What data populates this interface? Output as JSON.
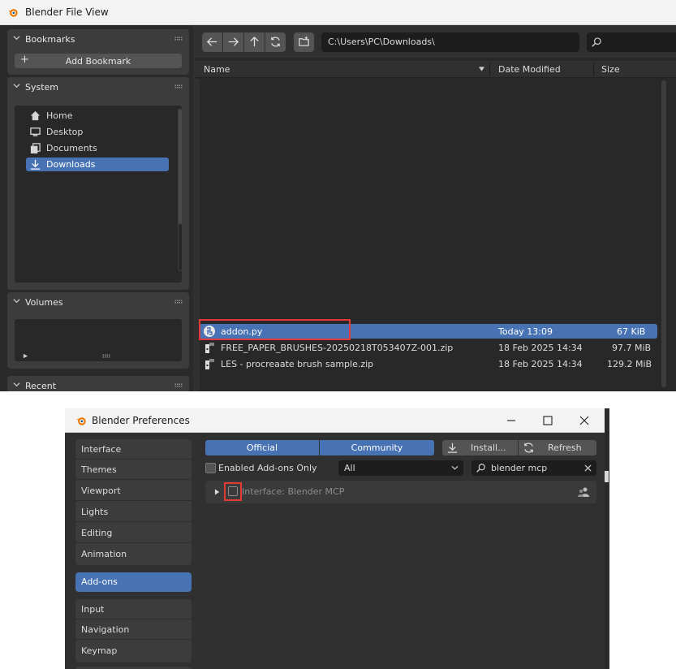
{
  "file_view": {
    "title": "Blender File View",
    "bookmarks": {
      "header": "Bookmarks",
      "add_label": "Add Bookmark"
    },
    "system": {
      "header": "System",
      "items": [
        {
          "label": "Home",
          "icon": "home-icon"
        },
        {
          "label": "Desktop",
          "icon": "desktop-icon"
        },
        {
          "label": "Documents",
          "icon": "documents-icon"
        },
        {
          "label": "Downloads",
          "icon": "download-icon",
          "selected": true
        }
      ]
    },
    "volumes": {
      "header": "Volumes"
    },
    "recent": {
      "header": "Recent"
    },
    "path": "C:\\Users\\PC\\Downloads\\",
    "columns": {
      "name": "Name",
      "date": "Date Modified",
      "size": "Size"
    },
    "files": [
      {
        "name": "addon.py",
        "date": "Today 13:09",
        "size": "67 KiB",
        "icon": "python-file-icon",
        "selected": true
      },
      {
        "name": "FREE_PAPER_BRUSHES-20250218T053407Z-001.zip",
        "date": "18 Feb 2025 14:34",
        "size": "97.7 MiB",
        "icon": "zip-file-icon"
      },
      {
        "name": "LES - procreaate brush sample.zip",
        "date": "18 Feb 2025 14:34",
        "size": "129.2 MiB",
        "icon": "zip-file-icon"
      }
    ]
  },
  "preferences": {
    "title": "Blender Preferences",
    "nav_groups": [
      [
        "Interface",
        "Themes",
        "Viewport",
        "Lights",
        "Editing",
        "Animation"
      ],
      [
        "Add-ons"
      ],
      [
        "Input",
        "Navigation",
        "Keymap"
      ]
    ],
    "tabs": {
      "official": "Official",
      "community": "Community"
    },
    "install_label": "Install...",
    "refresh_label": "Refresh",
    "enabled_only_label": "Enabled Add-ons Only",
    "category_value": "All",
    "search_value": "blender mcp",
    "addon": {
      "label": "Interface: Blender MCP",
      "enabled": false
    }
  },
  "colors": {
    "accent": "#4772b3",
    "highlight": "#e53935"
  }
}
